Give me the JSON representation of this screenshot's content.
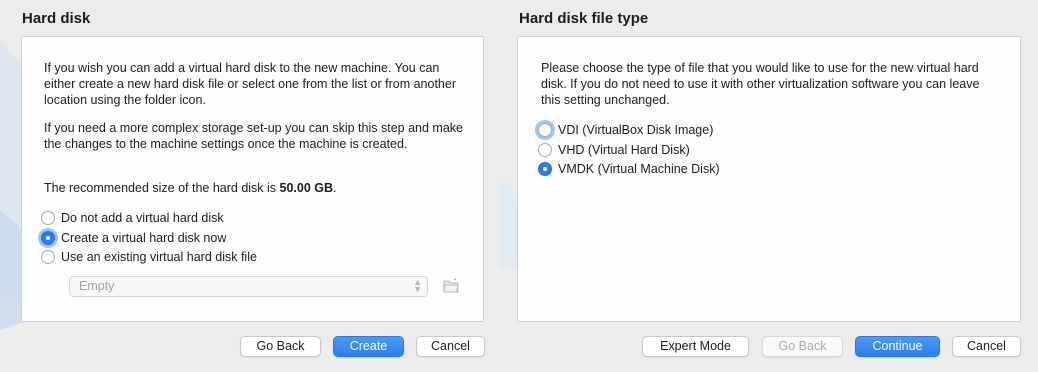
{
  "left_pane": {
    "title": "Hard disk",
    "paragraphs": [
      "If you wish you can add a virtual hard disk to the new machine. You can either create a new hard disk file or select one from the list or from another location using the folder icon.",
      "If you need a more complex storage set-up you can skip this step and make the changes to the machine settings once the machine is created."
    ],
    "recommended_prefix": "The recommended size of the hard disk is ",
    "recommended_size": "50.00 GB",
    "recommended_suffix": ".",
    "options": [
      {
        "label": "Do not add a virtual hard disk",
        "selected": false
      },
      {
        "label": "Create a virtual hard disk now",
        "selected": true
      },
      {
        "label": "Use an existing virtual hard disk file",
        "selected": false
      }
    ],
    "disk_select": {
      "value": "Empty",
      "disabled": true
    },
    "buttons": {
      "go_back": "Go Back",
      "create": "Create",
      "cancel": "Cancel"
    }
  },
  "right_pane": {
    "title": "Hard disk file type",
    "paragraph": "Please choose the type of file that you would like to use for the new virtual hard disk. If you do not need to use it with other virtualization software you can leave this setting unchanged.",
    "options": [
      {
        "label": "VDI (VirtualBox Disk Image)",
        "selected": false
      },
      {
        "label": "VHD (Virtual Hard Disk)",
        "selected": false
      },
      {
        "label": "VMDK (Virtual Machine Disk)",
        "selected": true
      }
    ],
    "buttons": {
      "expert_mode": "Expert Mode",
      "go_back": "Go Back",
      "continue": "Continue",
      "cancel": "Cancel"
    }
  },
  "colors": {
    "accent": "#2e7de9",
    "window_bg": "#ececec",
    "box_border": "#cfcfcf"
  },
  "icons": {
    "folder_picker": "folder-open-icon",
    "select_arrows": "up-down-chevron-icon"
  }
}
